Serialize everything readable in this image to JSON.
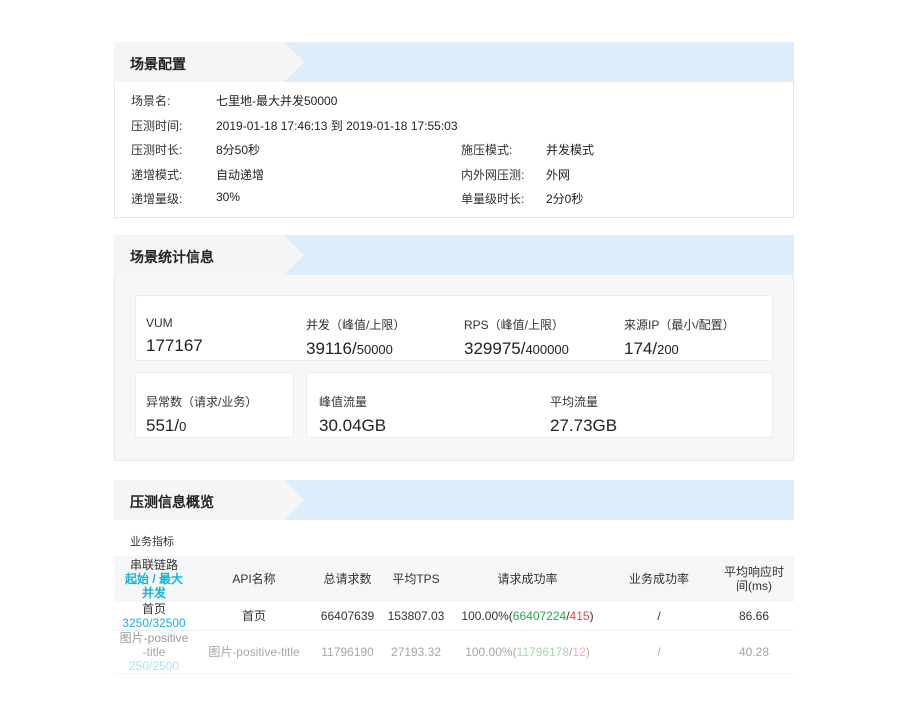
{
  "config": {
    "title": "场景配置",
    "rows": [
      {
        "l1": "场景名:",
        "v1": "七里地-最大并发50000",
        "l2": "",
        "v2": ""
      },
      {
        "l1": "压测时间:",
        "v1": "2019-01-18 17:46:13 到 2019-01-18 17:55:03",
        "l2": "",
        "v2": ""
      },
      {
        "l1": "压测时长:",
        "v1": "8分50秒",
        "l2": "施压模式:",
        "v2": "并发模式"
      },
      {
        "l1": "递增模式:",
        "v1": "自动递增",
        "l2": "内外网压测:",
        "v2": "外网"
      },
      {
        "l1": "递增量级:",
        "v1": "30%",
        "l2": "单量级时长:",
        "v2": "2分0秒"
      }
    ]
  },
  "stats": {
    "title": "场景统计信息",
    "vum": {
      "label": "VUM",
      "value": "177167"
    },
    "concurrency": {
      "label": "并发（峰值/上限）",
      "value": "39116/",
      "limit": "50000"
    },
    "rps": {
      "label": "RPS（峰值/上限）",
      "value": "329975/",
      "limit": "400000"
    },
    "source_ip": {
      "label": "来源IP（最小/配置）",
      "value": "174/",
      "limit": "200"
    },
    "errors": {
      "label": "异常数（请求/业务）",
      "value": "551/",
      "limit": "0"
    },
    "peak_traffic": {
      "label": "峰值流量",
      "value": "30.04GB"
    },
    "avg_traffic": {
      "label": "平均流量",
      "value": "27.73GB"
    }
  },
  "overview": {
    "title": "压测信息概览",
    "subtitle": "业务指标",
    "headers": {
      "chain": "串联链路",
      "chain_sub": "起始 / 最大并发",
      "api": "API名称",
      "total": "总请求数",
      "tps": "平均TPS",
      "success": "请求成功率",
      "biz": "业务成功率",
      "rt": "平均响应时间(ms)"
    },
    "rows": [
      {
        "chain": "首页",
        "chain_conc": "3250/32500",
        "api": "首页",
        "total": "66407639",
        "tps": "153807.03",
        "rate": "100.00%",
        "ok": "66407224",
        "sep": "/",
        "fail": "415",
        "biz": "/",
        "rt": "86.66"
      },
      {
        "chain": "图片-positive-title",
        "chain_conc": "250/2500",
        "api": "图片-positive-title",
        "total": "11796190",
        "tps": "27193.32",
        "rate": "100.00%",
        "ok": "11796178",
        "sep": "/",
        "fail": "12",
        "biz": "/",
        "rt": "40.28"
      }
    ]
  }
}
